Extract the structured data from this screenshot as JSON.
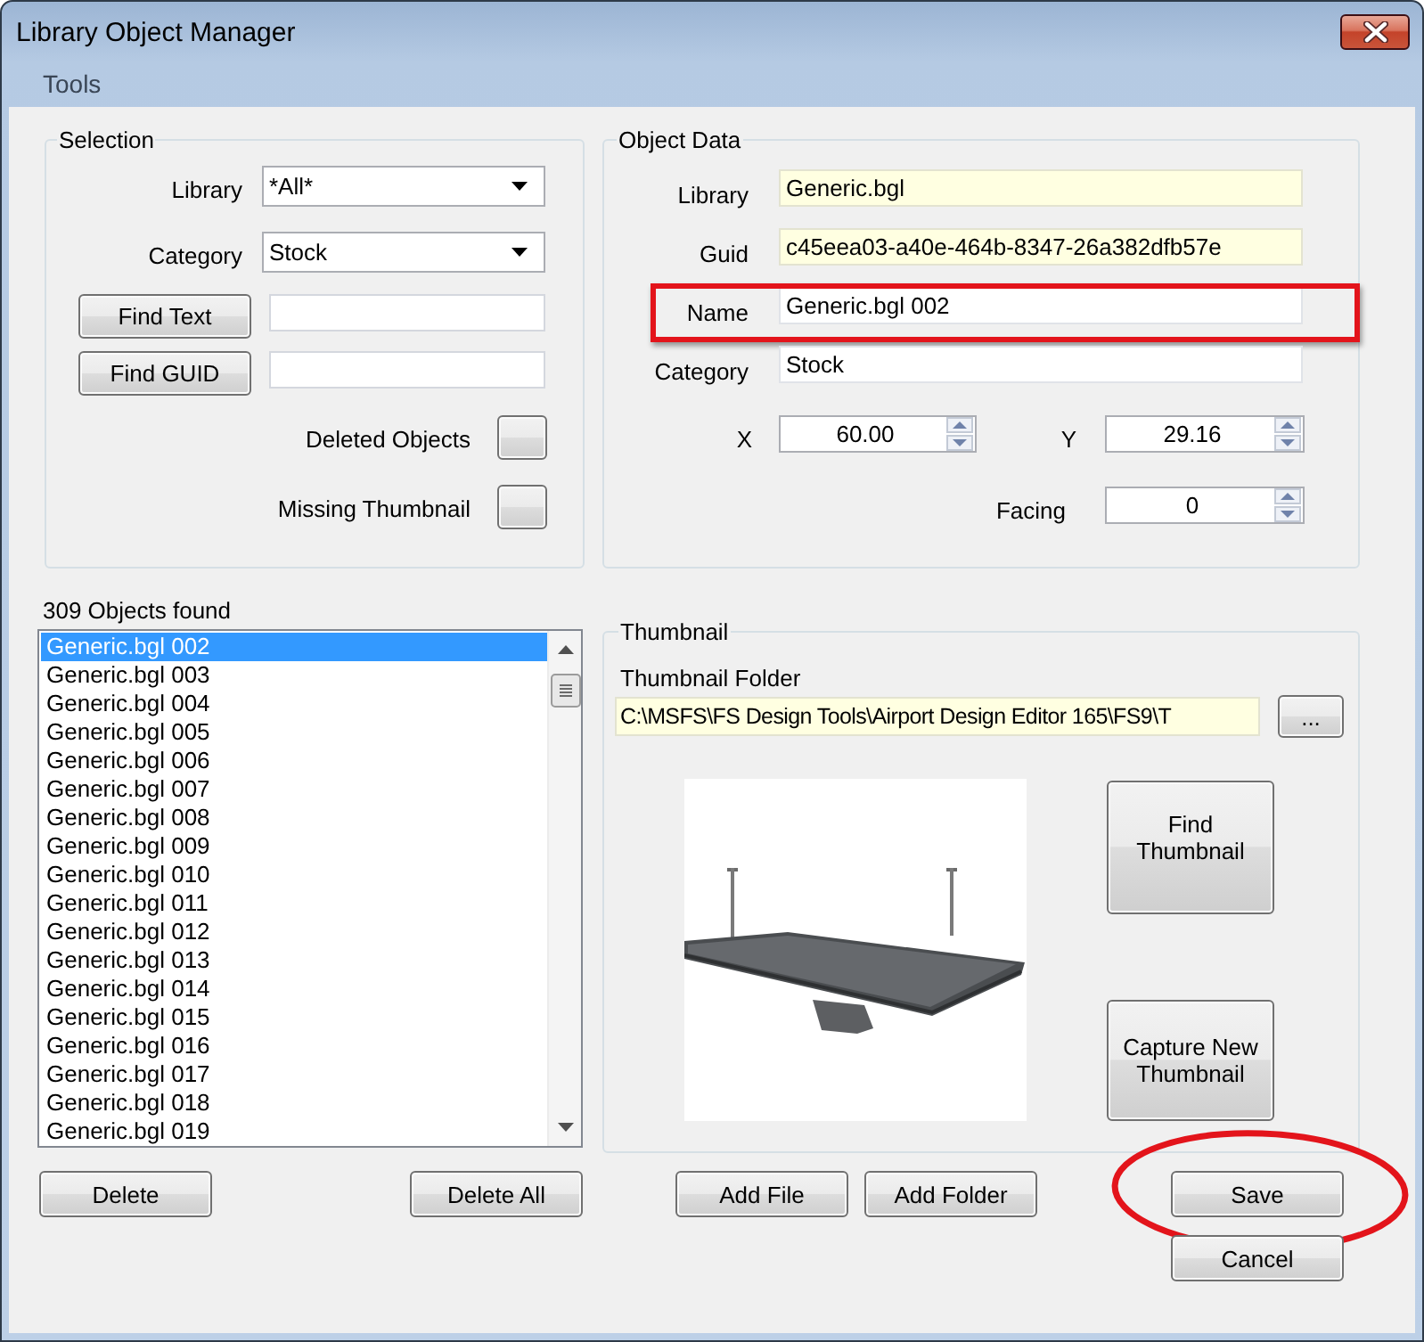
{
  "window": {
    "title": "Library Object Manager"
  },
  "menu": [
    {
      "label": "Tools"
    }
  ],
  "selection": {
    "title": "Selection",
    "rows": [
      {
        "kind": "dropdown",
        "label": "Library",
        "value": "*All*"
      },
      {
        "kind": "dropdown",
        "label": "Category",
        "value": "Stock"
      },
      {
        "kind": "search",
        "button": "Find Text"
      },
      {
        "kind": "search",
        "button": "Find GUID"
      },
      {
        "kind": "toggle",
        "label": "Deleted Objects",
        "pressed": false
      },
      {
        "kind": "toggle",
        "label": "Missing Thumbnail",
        "pressed": false
      }
    ]
  },
  "object_data": {
    "title": "Object Data",
    "fields": [
      {
        "label": "Library",
        "value": "Generic.bgl",
        "readonly": true
      },
      {
        "label": "Guid",
        "value": "c45eea03-a40e-464b-8347-26a382dfb57e",
        "readonly": true
      },
      {
        "label": "Name",
        "value": "Generic.bgl 002",
        "readonly": false,
        "highlighted": true
      },
      {
        "label": "Category",
        "value": "Stock",
        "readonly": false
      }
    ],
    "spinners": [
      {
        "label": "X",
        "value": "60.00"
      },
      {
        "label": "Y",
        "value": "29.16"
      },
      {
        "label": "Facing",
        "value": "0"
      }
    ]
  },
  "objects": {
    "count_label": "309 Objects found",
    "items": [
      {
        "text": "Generic.bgl 002",
        "selected": true
      },
      {
        "text": "Generic.bgl 003",
        "selected": false
      },
      {
        "text": "Generic.bgl 004",
        "selected": false
      },
      {
        "text": "Generic.bgl 005",
        "selected": false
      },
      {
        "text": "Generic.bgl 006",
        "selected": false
      },
      {
        "text": "Generic.bgl 007",
        "selected": false
      },
      {
        "text": "Generic.bgl 008",
        "selected": false
      },
      {
        "text": "Generic.bgl 009",
        "selected": false
      },
      {
        "text": "Generic.bgl 010",
        "selected": false
      },
      {
        "text": "Generic.bgl 011",
        "selected": false
      },
      {
        "text": "Generic.bgl 012",
        "selected": false
      },
      {
        "text": "Generic.bgl 013",
        "selected": false
      },
      {
        "text": "Generic.bgl 014",
        "selected": false
      },
      {
        "text": "Generic.bgl 015",
        "selected": false
      },
      {
        "text": "Generic.bgl 016",
        "selected": false
      },
      {
        "text": "Generic.bgl 017",
        "selected": false
      },
      {
        "text": "Generic.bgl 018",
        "selected": false
      },
      {
        "text": "Generic.bgl 019",
        "selected": false
      }
    ],
    "buttons": [
      {
        "label": "Delete"
      },
      {
        "label": "Delete All"
      }
    ]
  },
  "thumbnail": {
    "title": "Thumbnail",
    "folder_label": "Thumbnail Folder",
    "folder_path": "C:\\MSFS\\FS Design Tools\\Airport Design Editor 165\\FS9\\T",
    "browse_button": "...",
    "buttons": [
      {
        "label": "Find Thumbnail"
      },
      {
        "label": "Capture New Thumbnail"
      }
    ]
  },
  "actions": [
    {
      "label": "Add File"
    },
    {
      "label": "Add Folder"
    },
    {
      "label": "Save",
      "highlighted": true
    },
    {
      "label": "Cancel"
    }
  ]
}
